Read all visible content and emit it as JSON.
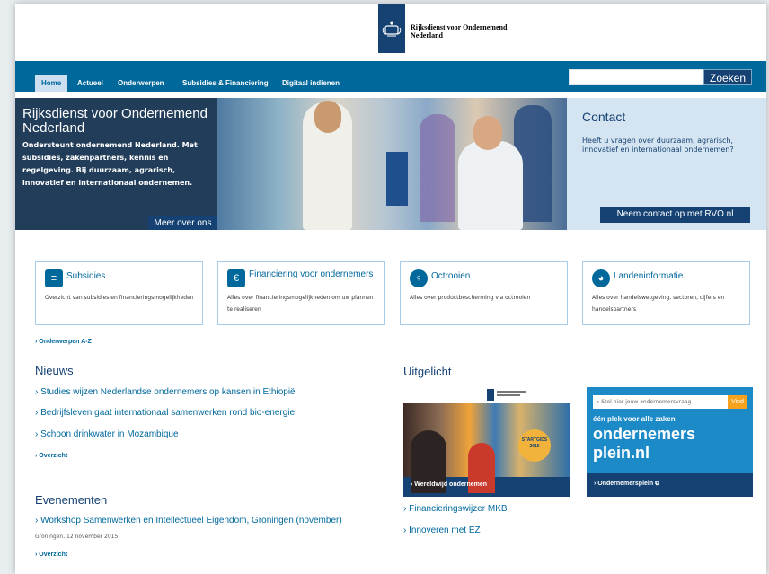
{
  "header": {
    "org_line1": "Rijksdienst voor Ondernemend",
    "org_line2": "Nederland"
  },
  "nav": {
    "items": [
      "Home",
      "Actueel",
      "Onderwerpen",
      "Subsidies & Financiering",
      "Digitaal indienen"
    ],
    "active": "Home",
    "search_placeholder": "",
    "search_button": "Zoeken"
  },
  "hero": {
    "title": "Rijksdienst voor Ondernemend Nederland",
    "description": "Ondersteunt ondernemend Nederland. Met subsidies, zakenpartners, kennis en regelgeving. Bij duurzaam, agrarisch, innovatief en internationaal ondernemen.",
    "more_button": "Meer over ons"
  },
  "contact": {
    "title": "Contact",
    "description": "Heeft u vragen over duurzaam, agrarisch, innovatief en internationaal ondernemen?",
    "button": "Neem contact op met RVO.nl"
  },
  "cards": [
    {
      "title": "Subsidies",
      "description": "Overzicht van subsidies en financieringsmogelijkheden",
      "icon": "document-icon"
    },
    {
      "title": "Financiering voor ondernemers",
      "description": "Alles over financieringsmogelijkheden om uw plannen te realiseren",
      "icon": "euro-icon"
    },
    {
      "title": "Octrooien",
      "description": "Alles over productbescherming via octrooien",
      "icon": "lightbulb-icon"
    },
    {
      "title": "Landeninformatie",
      "description": "Alles over handelswetgeving, sectoren, cijfers en handelspartners",
      "icon": "globe-icon"
    }
  ],
  "topics_link": "› Onderwerpen A-Z",
  "news": {
    "title": "Nieuws",
    "items": [
      "› Studies wijzen Nederlandse ondernemers op kansen in Ethiopië",
      "› Bedrijfsleven gaat internationaal samenwerken rond bio-energie",
      "› Schoon drinkwater in Mozambique"
    ],
    "overview": "› Overzicht"
  },
  "events": {
    "title": "Evenementen",
    "item": "› Workshop Samenwerken en Intellectueel Eigendom, Groningen (november)",
    "date": "Groningen, 12 november 2015",
    "overview": "› Overzicht"
  },
  "featured": {
    "title": "Uitgelicht",
    "banner1_badge": "STARTGIDS 2015",
    "banner1_label": "› Wereldwijd ondernemen",
    "banner2_search": "Stel hier jouw ondernemersvraag",
    "banner2_button": "Vind",
    "banner2_tagline": "één plek voor alle zaken",
    "banner2_brand_line1": "ondernemers",
    "banner2_brand_line2": "plein.nl",
    "banner2_label": "› Ondernemersplein ⧉",
    "links": [
      "› Financieringswijzer MKB",
      "› Innoveren met EZ"
    ]
  },
  "colors": {
    "nav": "#01689b",
    "dark_blue": "#154273",
    "contact_bg": "#d4e4f0",
    "accent_orange": "#f6a21d"
  }
}
